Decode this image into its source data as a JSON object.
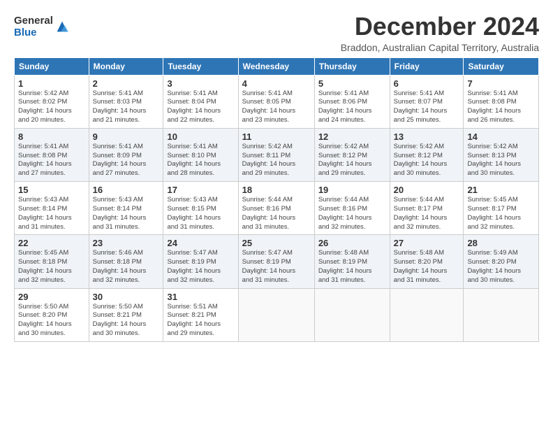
{
  "logo": {
    "general": "General",
    "blue": "Blue"
  },
  "header": {
    "month": "December 2024",
    "location": "Braddon, Australian Capital Territory, Australia"
  },
  "weekdays": [
    "Sunday",
    "Monday",
    "Tuesday",
    "Wednesday",
    "Thursday",
    "Friday",
    "Saturday"
  ],
  "weeks": [
    [
      {
        "day": "1",
        "sunrise": "Sunrise: 5:42 AM",
        "sunset": "Sunset: 8:02 PM",
        "daylight": "Daylight: 14 hours and 20 minutes."
      },
      {
        "day": "2",
        "sunrise": "Sunrise: 5:41 AM",
        "sunset": "Sunset: 8:03 PM",
        "daylight": "Daylight: 14 hours and 21 minutes."
      },
      {
        "day": "3",
        "sunrise": "Sunrise: 5:41 AM",
        "sunset": "Sunset: 8:04 PM",
        "daylight": "Daylight: 14 hours and 22 minutes."
      },
      {
        "day": "4",
        "sunrise": "Sunrise: 5:41 AM",
        "sunset": "Sunset: 8:05 PM",
        "daylight": "Daylight: 14 hours and 23 minutes."
      },
      {
        "day": "5",
        "sunrise": "Sunrise: 5:41 AM",
        "sunset": "Sunset: 8:06 PM",
        "daylight": "Daylight: 14 hours and 24 minutes."
      },
      {
        "day": "6",
        "sunrise": "Sunrise: 5:41 AM",
        "sunset": "Sunset: 8:07 PM",
        "daylight": "Daylight: 14 hours and 25 minutes."
      },
      {
        "day": "7",
        "sunrise": "Sunrise: 5:41 AM",
        "sunset": "Sunset: 8:08 PM",
        "daylight": "Daylight: 14 hours and 26 minutes."
      }
    ],
    [
      {
        "day": "8",
        "sunrise": "Sunrise: 5:41 AM",
        "sunset": "Sunset: 8:08 PM",
        "daylight": "Daylight: 14 hours and 27 minutes."
      },
      {
        "day": "9",
        "sunrise": "Sunrise: 5:41 AM",
        "sunset": "Sunset: 8:09 PM",
        "daylight": "Daylight: 14 hours and 27 minutes."
      },
      {
        "day": "10",
        "sunrise": "Sunrise: 5:41 AM",
        "sunset": "Sunset: 8:10 PM",
        "daylight": "Daylight: 14 hours and 28 minutes."
      },
      {
        "day": "11",
        "sunrise": "Sunrise: 5:42 AM",
        "sunset": "Sunset: 8:11 PM",
        "daylight": "Daylight: 14 hours and 29 minutes."
      },
      {
        "day": "12",
        "sunrise": "Sunrise: 5:42 AM",
        "sunset": "Sunset: 8:12 PM",
        "daylight": "Daylight: 14 hours and 29 minutes."
      },
      {
        "day": "13",
        "sunrise": "Sunrise: 5:42 AM",
        "sunset": "Sunset: 8:12 PM",
        "daylight": "Daylight: 14 hours and 30 minutes."
      },
      {
        "day": "14",
        "sunrise": "Sunrise: 5:42 AM",
        "sunset": "Sunset: 8:13 PM",
        "daylight": "Daylight: 14 hours and 30 minutes."
      }
    ],
    [
      {
        "day": "15",
        "sunrise": "Sunrise: 5:43 AM",
        "sunset": "Sunset: 8:14 PM",
        "daylight": "Daylight: 14 hours and 31 minutes."
      },
      {
        "day": "16",
        "sunrise": "Sunrise: 5:43 AM",
        "sunset": "Sunset: 8:14 PM",
        "daylight": "Daylight: 14 hours and 31 minutes."
      },
      {
        "day": "17",
        "sunrise": "Sunrise: 5:43 AM",
        "sunset": "Sunset: 8:15 PM",
        "daylight": "Daylight: 14 hours and 31 minutes."
      },
      {
        "day": "18",
        "sunrise": "Sunrise: 5:44 AM",
        "sunset": "Sunset: 8:16 PM",
        "daylight": "Daylight: 14 hours and 31 minutes."
      },
      {
        "day": "19",
        "sunrise": "Sunrise: 5:44 AM",
        "sunset": "Sunset: 8:16 PM",
        "daylight": "Daylight: 14 hours and 32 minutes."
      },
      {
        "day": "20",
        "sunrise": "Sunrise: 5:44 AM",
        "sunset": "Sunset: 8:17 PM",
        "daylight": "Daylight: 14 hours and 32 minutes."
      },
      {
        "day": "21",
        "sunrise": "Sunrise: 5:45 AM",
        "sunset": "Sunset: 8:17 PM",
        "daylight": "Daylight: 14 hours and 32 minutes."
      }
    ],
    [
      {
        "day": "22",
        "sunrise": "Sunrise: 5:45 AM",
        "sunset": "Sunset: 8:18 PM",
        "daylight": "Daylight: 14 hours and 32 minutes."
      },
      {
        "day": "23",
        "sunrise": "Sunrise: 5:46 AM",
        "sunset": "Sunset: 8:18 PM",
        "daylight": "Daylight: 14 hours and 32 minutes."
      },
      {
        "day": "24",
        "sunrise": "Sunrise: 5:47 AM",
        "sunset": "Sunset: 8:19 PM",
        "daylight": "Daylight: 14 hours and 32 minutes."
      },
      {
        "day": "25",
        "sunrise": "Sunrise: 5:47 AM",
        "sunset": "Sunset: 8:19 PM",
        "daylight": "Daylight: 14 hours and 31 minutes."
      },
      {
        "day": "26",
        "sunrise": "Sunrise: 5:48 AM",
        "sunset": "Sunset: 8:19 PM",
        "daylight": "Daylight: 14 hours and 31 minutes."
      },
      {
        "day": "27",
        "sunrise": "Sunrise: 5:48 AM",
        "sunset": "Sunset: 8:20 PM",
        "daylight": "Daylight: 14 hours and 31 minutes."
      },
      {
        "day": "28",
        "sunrise": "Sunrise: 5:49 AM",
        "sunset": "Sunset: 8:20 PM",
        "daylight": "Daylight: 14 hours and 30 minutes."
      }
    ],
    [
      {
        "day": "29",
        "sunrise": "Sunrise: 5:50 AM",
        "sunset": "Sunset: 8:20 PM",
        "daylight": "Daylight: 14 hours and 30 minutes."
      },
      {
        "day": "30",
        "sunrise": "Sunrise: 5:50 AM",
        "sunset": "Sunset: 8:21 PM",
        "daylight": "Daylight: 14 hours and 30 minutes."
      },
      {
        "day": "31",
        "sunrise": "Sunrise: 5:51 AM",
        "sunset": "Sunset: 8:21 PM",
        "daylight": "Daylight: 14 hours and 29 minutes."
      },
      null,
      null,
      null,
      null
    ]
  ]
}
